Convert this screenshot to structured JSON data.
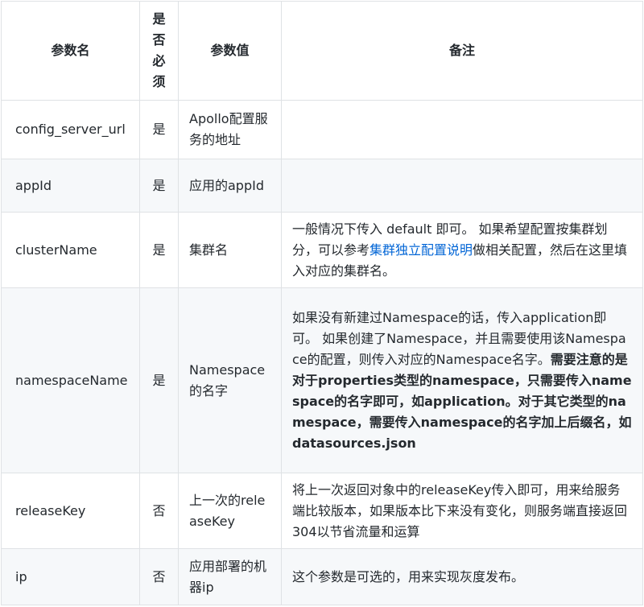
{
  "table": {
    "headers": {
      "name": "参数名",
      "required": [
        "是",
        "否",
        "必",
        "须"
      ],
      "value": "参数值",
      "note": "备注"
    },
    "rows": [
      {
        "name": "config_server_url",
        "required": "是",
        "value": "Apollo配置服务的地址",
        "note": {
          "pre": "",
          "link": "",
          "post": "",
          "bold": ""
        }
      },
      {
        "name": "appId",
        "required": "是",
        "value": "应用的appId",
        "note": {
          "pre": "",
          "link": "",
          "post": "",
          "bold": ""
        }
      },
      {
        "name": "clusterName",
        "required": "是",
        "value": "集群名",
        "note": {
          "pre": "一般情况下传入 default 即可。 如果希望配置按集群划分，可以参考",
          "link": "集群独立配置说明",
          "post": "做相关配置，然后在这里填入对应的集群名。",
          "bold": ""
        }
      },
      {
        "name": "namespaceName",
        "required": "是",
        "value": "Namespace的名字",
        "note": {
          "pre": "如果没有新建过Namespace的话，传入application即可。 如果创建了Namespace，并且需要使用该Namespace的配置，则传入对应的Namespace名字。",
          "link": "",
          "post": "",
          "bold": "需要注意的是对于properties类型的namespace，只需要传入namespace的名字即可，如application。对于其它类型的namespace，需要传入namespace的名字加上后缀名，如datasources.json"
        }
      },
      {
        "name": "releaseKey",
        "required": "否",
        "value": "上一次的releaseKey",
        "note": {
          "pre": "将上一次返回对象中的releaseKey传入即可，用来给服务端比较版本，如果版本比下来没有变化，则服务端直接返回304以节省流量和运算",
          "link": "",
          "post": "",
          "bold": ""
        }
      },
      {
        "name": "ip",
        "required": "否",
        "value": "应用部署的机器ip",
        "note": {
          "pre": "这个参数是可选的，用来实现灰度发布。",
          "link": "",
          "post": "",
          "bold": ""
        }
      }
    ]
  }
}
